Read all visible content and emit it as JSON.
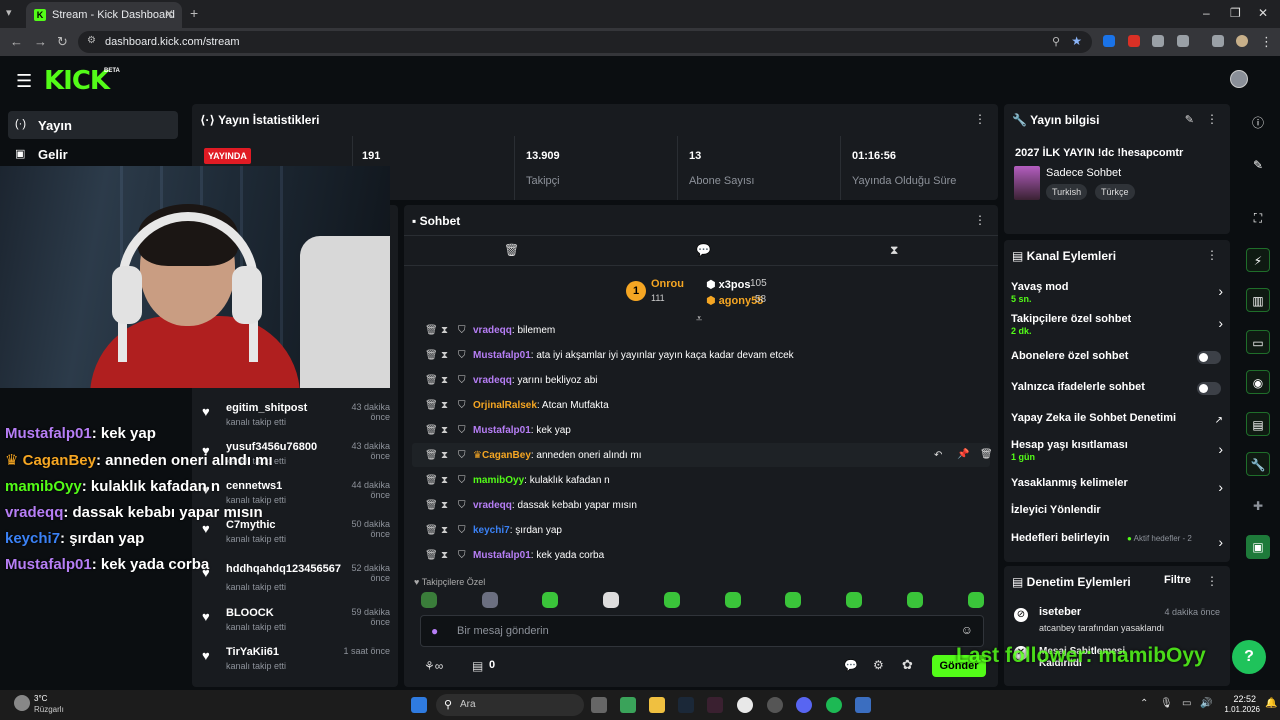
{
  "browser": {
    "tab_title": "Stream - Kick Dashboard",
    "url": "dashboard.kick.com/stream"
  },
  "header": {
    "logo": "KICK",
    "beta": "BETA"
  },
  "nav": [
    {
      "label": "Yayın",
      "icon": "broadcast-icon"
    },
    {
      "label": "Gelir",
      "icon": "revenue-icon"
    }
  ],
  "stats": {
    "title": "Yayın İstatistikleri",
    "live_badge": "YAYINDA",
    "viewers_value": "191",
    "viewers_label": "cı",
    "followers_value": "13.909",
    "followers_label": "Takipçi",
    "subs_value": "13",
    "subs_label": "Abone Sayısı",
    "uptime_value": "01:16:56",
    "uptime_label": "Yayında Olduğu Süre"
  },
  "overlay_chat": [
    {
      "user": "Mustafalp01",
      "text": ": kek yap",
      "color": "#b67ef5",
      "badge": false
    },
    {
      "user": "CaganBey",
      "text": ": anneden oneri alındı mı",
      "color": "#f5a623",
      "badge": true
    },
    {
      "user": "mamibOyy",
      "text": ": kulaklık kafadan n",
      "color": "#53fc18",
      "badge": false
    },
    {
      "user": "vradeqq",
      "text": ": dassak kebabı yapar mısın",
      "color": "#b67ef5",
      "badge": false
    },
    {
      "user": "keychi7",
      "text": ": şırdan yap",
      "color": "#3b82f6",
      "badge": false
    },
    {
      "user": "Mustafalp01",
      "text": ": kek yada corba",
      "color": "#b67ef5",
      "badge": false
    }
  ],
  "followers": [
    {
      "name": "egitim_shitpost",
      "sub": "kanalı takip etti",
      "time": "43 dakika önce"
    },
    {
      "name": "yusuf3456u76800",
      "sub": "kanalı takip etti",
      "time": "43 dakika önce"
    },
    {
      "name": "cennetws1",
      "sub": "kanalı takip etti",
      "time": "44 dakika önce"
    },
    {
      "name": "C7mythic",
      "sub": "kanalı takip etti",
      "time": "50 dakika önce"
    },
    {
      "name": "hddhqahdq123456567",
      "sub": "kanalı takip etti",
      "time": "52 dakika önce"
    },
    {
      "name": "BLOOCK",
      "sub": "kanalı takip etti",
      "time": "59 dakika önce"
    },
    {
      "name": "TirYaKii61",
      "sub": "kanalı takip etti",
      "time": "1 saat önce"
    }
  ],
  "chat": {
    "title": "Sohbet",
    "leader": {
      "name": "Onrou",
      "count": "111",
      "rank": "1"
    },
    "top2": {
      "name": "x3pos",
      "count": "105"
    },
    "top3": {
      "name": "agony55",
      "count": "58"
    },
    "messages": [
      {
        "user": "vradeqq",
        "text": ": bilemem",
        "color": "#b67ef5",
        "crown": false
      },
      {
        "user": "Mustafalp01",
        "text": ": ata iyi akşamlar iyi yayınlar yayın kaça kadar devam etcek",
        "color": "#b67ef5",
        "crown": false
      },
      {
        "user": "vradeqq",
        "text": ": yarını bekliyoz abi",
        "color": "#b67ef5",
        "crown": false
      },
      {
        "user": "OrjinalRalsek",
        "text": ": Atcan Mutfakta",
        "color": "#f5a623",
        "crown": false
      },
      {
        "user": "Mustafalp01",
        "text": ": kek yap",
        "color": "#b67ef5",
        "crown": false
      },
      {
        "user": "CaganBey",
        "text": ": anneden oneri alındı mı",
        "color": "#f5a623",
        "crown": true
      },
      {
        "user": "mamibOyy",
        "text": ": kulaklık kafadan n",
        "color": "#53fc18",
        "crown": false
      },
      {
        "user": "vradeqq",
        "text": ": dassak kebabı yapar mısın",
        "color": "#b67ef5",
        "crown": false
      },
      {
        "user": "keychi7",
        "text": ": şırdan yap",
        "color": "#3b82f6",
        "crown": false
      },
      {
        "user": "Mustafalp01",
        "text": ": kek yada corba",
        "color": "#b67ef5",
        "crown": false
      }
    ],
    "followers_only": "Takipçilere Özel",
    "placeholder": "Bir mesaj gönderin",
    "count": "0",
    "send": "Gönder"
  },
  "stream_info": {
    "title": "Yayın bilgisi",
    "stream_title": "2027 İLK YAYIN !dc !hesapcomtr",
    "category": "Sadece Sohbet",
    "tags": [
      "Turkish",
      "Türkçe"
    ]
  },
  "channel_actions": {
    "title": "Kanal Eylemleri",
    "slow_mode": "Yavaş mod",
    "slow_mode_val": "5 sn.",
    "followers_chat": "Takipçilere özel sohbet",
    "followers_chat_val": "2 dk.",
    "subs_chat": "Abonelere özel sohbet",
    "emote_chat": "Yalnızca ifadelerle sohbet",
    "ai_mod": "Yapay Zeka ile Sohbet Denetimi",
    "age": "Hesap yaşı kısıtlaması",
    "age_val": "1 gün",
    "banned_words": "Yasaklanmış kelimeler",
    "raid": "İzleyici Yönlendir",
    "goals": "Hedefleri belirleyin",
    "goals_status": "Aktif hedefler - 2"
  },
  "mod_actions": {
    "title": "Denetim Eylemleri",
    "filter": "Filtre",
    "items": [
      {
        "user": "iseteber",
        "sub": "atcanbey tarafından yasaklandı",
        "time": "4 dakika önce"
      },
      {
        "user": "Mesaj Sabitlemesi Kaldırıldı",
        "sub": "",
        "time": ""
      }
    ]
  },
  "overlay_follower": "Last follower: mamibOyy",
  "taskbar": {
    "temp": "3°C",
    "weather": "Rüzgarlı",
    "search": "Ara",
    "time": "22:52",
    "date": "1.01.2026"
  }
}
